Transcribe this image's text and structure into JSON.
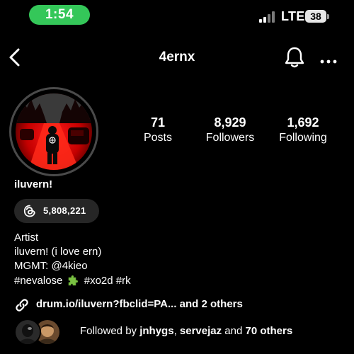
{
  "status_bar": {
    "time": "1:54",
    "carrier": "LTE",
    "battery": "38"
  },
  "header": {
    "username": "4ernx",
    "icons": {
      "back": "chevron-left-icon",
      "notifications": "bell-icon",
      "more": "more-horizontal-icon"
    }
  },
  "stats": [
    {
      "value": "71",
      "label": "Posts"
    },
    {
      "value": "8,929",
      "label": "Followers"
    },
    {
      "value": "1,692",
      "label": "Following"
    }
  ],
  "profile": {
    "display_name": "iluvern!",
    "threads_count": "5,808,221",
    "bio": {
      "category": "Artist",
      "line1": "iluvern! (i love ern)",
      "line2": "MGMT: @4kieo",
      "hashtag1": "#nevalose",
      "hashtags2": "#xo2d #rk"
    },
    "link": {
      "url": "drum.io/iluvern?fbclid=PA...",
      "others": "and 2 others"
    },
    "followed_by": {
      "prefix": "Followed by",
      "user1": "jnhygs",
      "separator": ",",
      "user2": "servejaz",
      "and": "and",
      "others": "70 others"
    }
  },
  "colors": {
    "time_pill": "#34c759",
    "background": "#000000",
    "pill_bg": "#262626",
    "puzzle_emoji": "#7ac143"
  }
}
